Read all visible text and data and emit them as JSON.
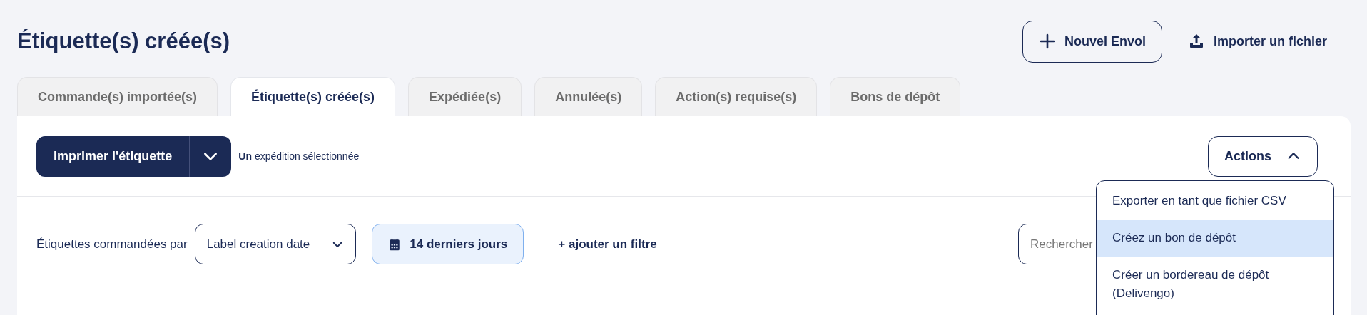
{
  "page_title": "Étiquette(s) créée(s)",
  "header_actions": [
    {
      "kind": "outlined",
      "label": "Nouvel Envoi"
    },
    {
      "kind": "link",
      "label": "Importer un fichier"
    }
  ],
  "tabs": [
    {
      "label": "Commande(s) importée(s)",
      "selected": false
    },
    {
      "label": "Étiquette(s) créée(s)",
      "selected": true
    },
    {
      "label": "Expédiée(s)",
      "selected": false
    },
    {
      "label": "Annulée(s)",
      "selected": false
    },
    {
      "label": "Action(s) requise(s)",
      "selected": false
    },
    {
      "label": "Bons de dépôt",
      "selected": false
    }
  ],
  "toolbar": {
    "print_button": "Imprimer l'étiquette",
    "selection_text": "**Un** expédition sélectionnée",
    "actions_button": "Actions",
    "actions_expanded": true
  },
  "actions_menu": [
    {
      "label": "Exporter en tant que fichier CSV",
      "selected": false
    },
    {
      "label": "Créez un bon de dépôt",
      "selected": true
    },
    {
      "label": "Créer un bordereau de dépôt (Delivengo)",
      "selected": false
    }
  ],
  "filters": {
    "sort_label": "Étiquettes commandées par",
    "sort_value": "Label creation date",
    "date_range": "14 derniers jours",
    "add_filter": "+ ajouter un filtre",
    "search_placeholder": "Rechercher"
  }
}
